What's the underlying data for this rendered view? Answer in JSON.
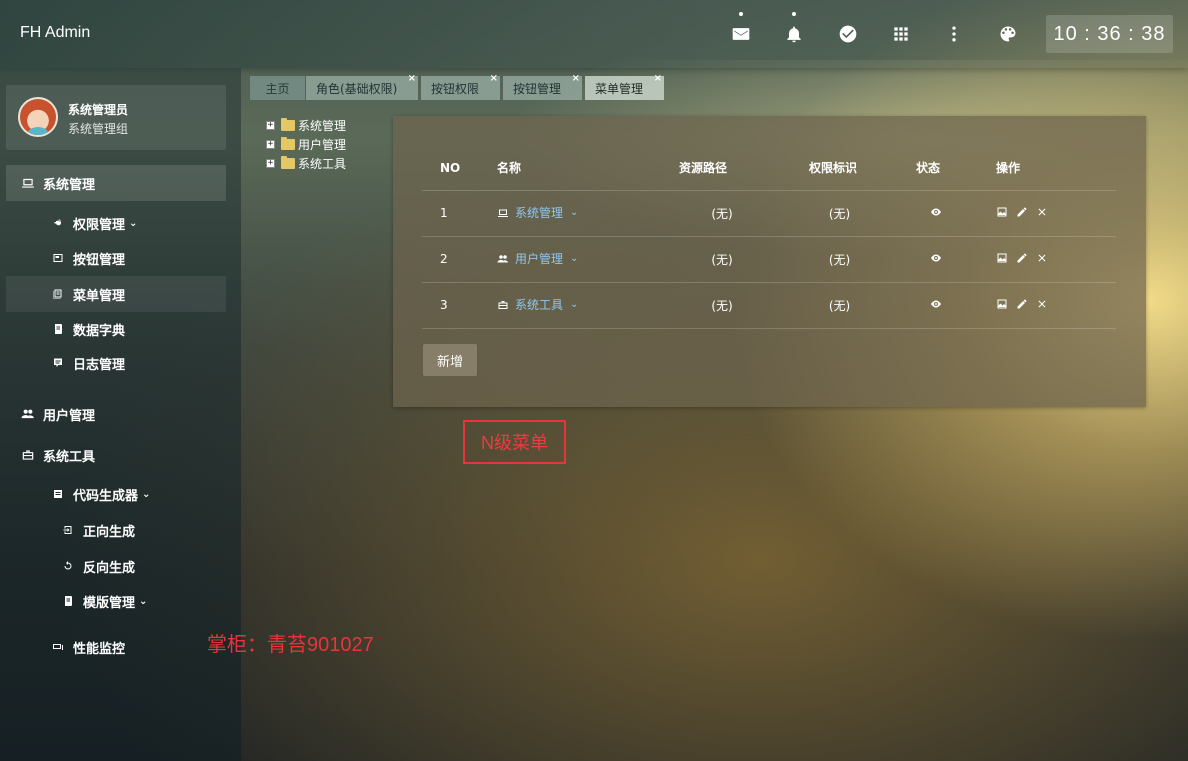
{
  "header": {
    "brand": "FH Admin",
    "clock": "10 : 36 : 38",
    "icons": [
      "mail-icon",
      "bell-icon",
      "check-circle-icon",
      "apps-grid-icon",
      "more-vert-icon",
      "palette-icon"
    ]
  },
  "user": {
    "name": "系统管理员",
    "group": "系统管理组"
  },
  "sidebar": {
    "items": [
      {
        "label": "系统管理",
        "icon": "laptop-icon"
      },
      {
        "label": "权限管理",
        "icon": "key-icon"
      },
      {
        "label": "按钮管理",
        "icon": "button-icon"
      },
      {
        "label": "菜单管理",
        "icon": "menu-icon"
      },
      {
        "label": "数据字典",
        "icon": "book-icon"
      },
      {
        "label": "日志管理",
        "icon": "log-icon"
      },
      {
        "label": "用户管理",
        "icon": "users-icon"
      },
      {
        "label": "系统工具",
        "icon": "toolbox-icon"
      },
      {
        "label": "代码生成器",
        "icon": "code-icon"
      },
      {
        "label": "正向生成",
        "icon": "forward-icon"
      },
      {
        "label": "反向生成",
        "icon": "reverse-icon"
      },
      {
        "label": "模版管理",
        "icon": "template-icon"
      },
      {
        "label": "性能监控",
        "icon": "monitor-icon"
      }
    ]
  },
  "tabs": [
    {
      "label": "主页"
    },
    {
      "label": "角色(基础权限)"
    },
    {
      "label": "按钮权限"
    },
    {
      "label": "按钮管理"
    },
    {
      "label": "菜单管理"
    }
  ],
  "tree": [
    {
      "label": "系统管理"
    },
    {
      "label": "用户管理"
    },
    {
      "label": "系统工具"
    }
  ],
  "table": {
    "headers": {
      "no": "NO",
      "name": "名称",
      "path": "资源路径",
      "perm": "权限标识",
      "state": "状态",
      "op": "操作"
    },
    "rows": [
      {
        "no": "1",
        "name": "系统管理",
        "icon": "laptop-icon",
        "path": "(无)",
        "perm": "(无)"
      },
      {
        "no": "2",
        "name": "用户管理",
        "icon": "users-icon",
        "path": "(无)",
        "perm": "(无)"
      },
      {
        "no": "3",
        "name": "系统工具",
        "icon": "toolbox-icon",
        "path": "(无)",
        "perm": "(无)"
      }
    ],
    "add_label": "新增"
  },
  "annotation": "N级菜单",
  "watermark": "掌柜：青苔901027"
}
